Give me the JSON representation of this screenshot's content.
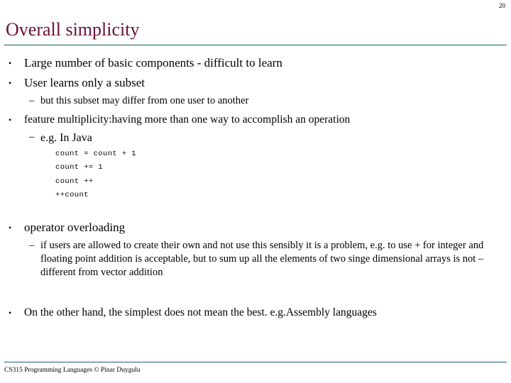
{
  "slide": {
    "page_number": "20",
    "title": "Overall simplicity",
    "title_color": "#6B0F3A",
    "rule_color": "#11635F",
    "footer_rule_color": "#1A6173",
    "background_color": "#ffffff",
    "footer": "CS315 Programming Languages © Pinar Duygulu"
  },
  "bullets": {
    "b1": {
      "marker": "•",
      "text": "Large number of basic components - difficult to learn"
    },
    "b2": {
      "marker": "•",
      "text": "User learns only a subset"
    },
    "b2_sub1": {
      "marker": "–",
      "text": "but this subset may differ from one user to another"
    },
    "b3": {
      "marker": "•",
      "text": "feature multiplicity:having more than one way to accomplish an operation"
    },
    "b3_sub1": {
      "marker": "–",
      "text": "e.g. In Java"
    },
    "b4": {
      "marker": "•",
      "text": "operator overloading"
    },
    "b4_sub1": {
      "marker": "–",
      "text": "if users are allowed to create their own and not use this sensibly it is a problem, e.g. to use + for integer and floating point addition is acceptable, but to sum up all the elements of two singe dimensional arrays is not – different from vector addition"
    },
    "b5": {
      "marker": "•",
      "text": "On the other hand, the simplest does not mean the best. e.g.Assembly languages"
    }
  },
  "code": {
    "line1": "count = count + 1",
    "line2": "count += 1",
    "line3": "count ++",
    "line4": "++count"
  }
}
